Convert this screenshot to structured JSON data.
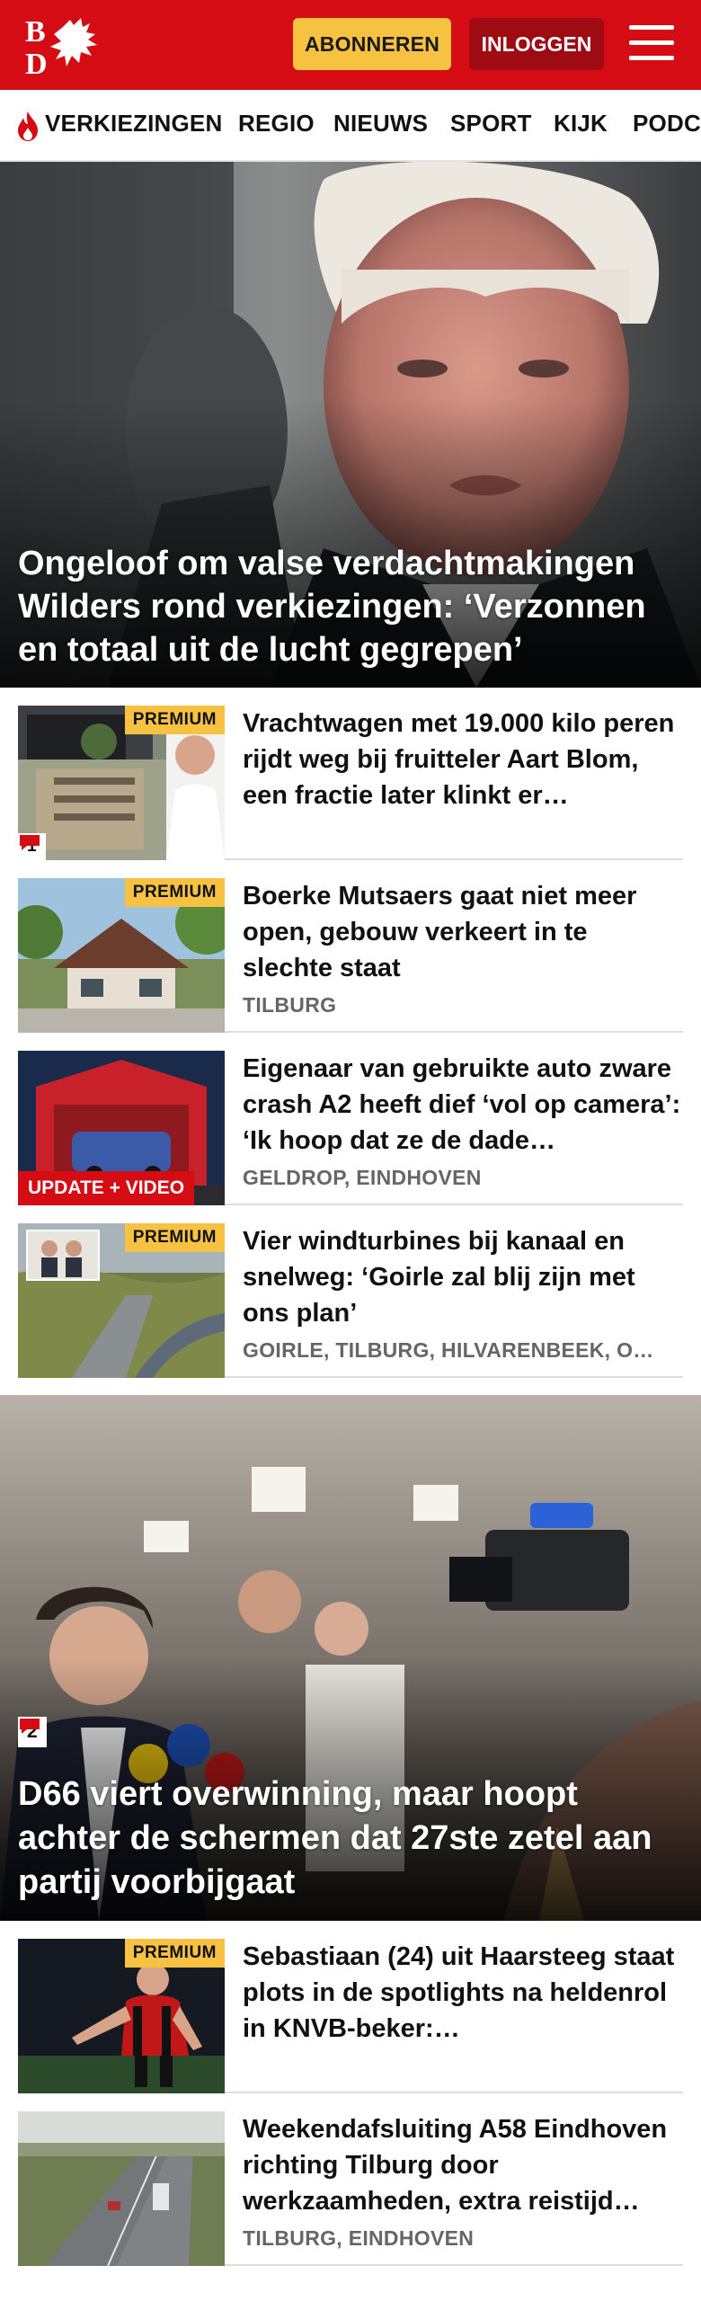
{
  "header": {
    "logo_text": "BD",
    "subscribe_label": "ABONNEREN",
    "login_label": "INLOGGEN"
  },
  "nav": {
    "items": [
      "VERKIEZINGEN",
      "REGIO",
      "NIEUWS",
      "SPORT",
      "KIJK",
      "PODC"
    ]
  },
  "hero": {
    "title": "Ongeloof om valse verdachtmakingen Wilders rond verkiezingen: ‘Verzonnen en totaal uit de lucht gegrepen’"
  },
  "articles": [
    {
      "title": "Vrachtwagen met 19.000 kilo peren rijdt weg bij fruitteler Aart Blom, een fractie later klinkt er…",
      "location": "",
      "premium": "PREMIUM",
      "comments": "1"
    },
    {
      "title": "Boerke Mutsaers gaat niet meer open, gebouw verkeert in te slechte staat",
      "location": "TILBURG",
      "premium": "PREMIUM"
    },
    {
      "title": "Eigenaar van gebruikte auto zware crash A2 heeft dief ‘vol op camera’: ‘Ik hoop dat ze de dade…",
      "location": "GELDROP, EINDHOVEN",
      "badge": "UPDATE + VIDEO"
    },
    {
      "title": "Vier windturbines bij kanaal en snelweg: ‘Goirle zal blij zijn met ons plan’",
      "location": "GOIRLE, TILBURG, HILVARENBEEK, O…",
      "premium": "PREMIUM"
    }
  ],
  "hero2": {
    "title": "D66 viert overwinning, maar hoopt achter de schermen dat 27ste zetel aan partij voorbijgaat",
    "comments": "2"
  },
  "articles2": [
    {
      "title": "Sebastiaan (24) uit Haarsteeg staat plots in de spotlights na heldenrol in KNVB-beker:…",
      "premium": "PREMIUM"
    },
    {
      "title": "Weekendafsluiting A58 Eindhoven richting Tilburg door werkzaamheden, extra reistijd…",
      "location": "TILBURG, EINDHOVEN"
    }
  ],
  "colors": {
    "brand_red": "#d50c13",
    "premium_yellow": "#f7c242",
    "login_dark_red": "#9e0b12"
  }
}
